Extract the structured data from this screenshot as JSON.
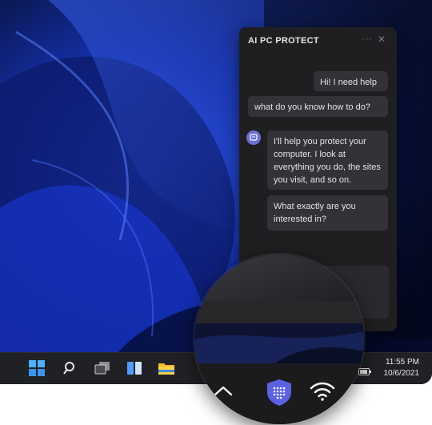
{
  "panel": {
    "title": "AI PC PROTECT",
    "more_icon": "more-icon",
    "close_icon": "close-icon",
    "messages": [
      {
        "from": "user",
        "text": "Hi! I need help"
      },
      {
        "from": "user",
        "text": "what do you know how to do?"
      },
      {
        "from": "bot",
        "text": "I'll help you protect your computer. I look at everything you do, the sites you visit, and so on."
      },
      {
        "from": "bot",
        "text": "What exactly are you interested in?"
      }
    ]
  },
  "taskbar": {
    "icons": [
      "windows-start-icon",
      "search-icon",
      "task-view-icon",
      "widgets-icon",
      "file-explorer-icon"
    ],
    "time": "11:55 PM",
    "date": "10/6/2021"
  },
  "tray_zoom": {
    "icons": [
      "chevron-up-icon",
      "shield-icon",
      "wifi-icon"
    ]
  },
  "colors": {
    "accent": "#5b62e0",
    "panel_bg": "#1f1f22",
    "bubble_bg": "#333337",
    "taskbar_bg": "#202124"
  }
}
